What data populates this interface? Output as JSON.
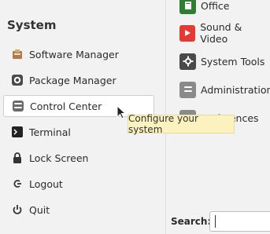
{
  "menu": {
    "title": "System",
    "items": [
      {
        "label": "Software Manager",
        "icon": "software-manager-icon"
      },
      {
        "label": "Package Manager",
        "icon": "package-manager-icon"
      },
      {
        "label": "Control Center",
        "icon": "control-center-icon",
        "selected": true
      },
      {
        "label": "Terminal",
        "icon": "terminal-icon"
      },
      {
        "label": "Lock Screen",
        "icon": "lock-icon"
      },
      {
        "label": "Logout",
        "icon": "logout-icon"
      },
      {
        "label": "Quit",
        "icon": "power-icon"
      }
    ]
  },
  "categories": [
    {
      "label": "Office",
      "icon": "office-icon",
      "color": "#2e7d32"
    },
    {
      "label": "Sound & Video",
      "icon": "play-icon",
      "color": "#e53935"
    },
    {
      "label": "System Tools",
      "icon": "system-tools-icon",
      "color": "#4a4a4a"
    },
    {
      "label": "Administration",
      "icon": "administration-icon",
      "color": "#8a8a8a"
    },
    {
      "label": "Preferences",
      "icon": "preferences-icon",
      "color": "#8a8a8a"
    }
  ],
  "tooltip": {
    "text": "Configure your system"
  },
  "search": {
    "label": "Search:",
    "value": ""
  },
  "colors": {
    "tooltip_bg": "#fbf2c0",
    "selected_bg": "#ffffff",
    "background": "#f2f2f2"
  }
}
